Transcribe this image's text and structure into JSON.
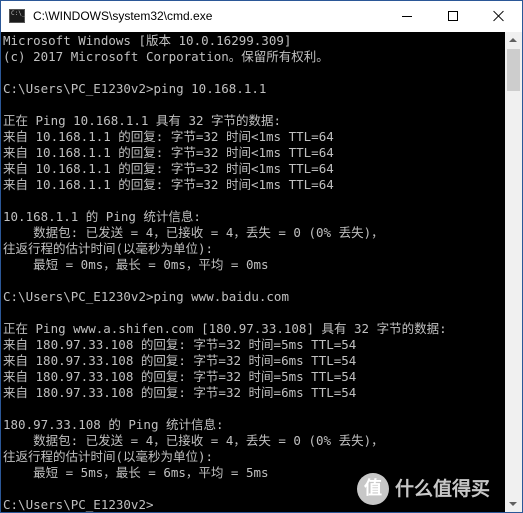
{
  "window": {
    "icon_text": "C:\\_",
    "title": "C:\\WINDOWS\\system32\\cmd.exe"
  },
  "console": {
    "lines": [
      "Microsoft Windows [版本 10.0.16299.309]",
      "(c) 2017 Microsoft Corporation。保留所有权利。",
      "",
      "C:\\Users\\PC_E1230v2>ping 10.168.1.1",
      "",
      "正在 Ping 10.168.1.1 具有 32 字节的数据:",
      "来自 10.168.1.1 的回复: 字节=32 时间<1ms TTL=64",
      "来自 10.168.1.1 的回复: 字节=32 时间<1ms TTL=64",
      "来自 10.168.1.1 的回复: 字节=32 时间<1ms TTL=64",
      "来自 10.168.1.1 的回复: 字节=32 时间<1ms TTL=64",
      "",
      "10.168.1.1 的 Ping 统计信息:",
      "    数据包: 已发送 = 4，已接收 = 4，丢失 = 0 (0% 丢失)，",
      "往返行程的估计时间(以毫秒为单位):",
      "    最短 = 0ms，最长 = 0ms，平均 = 0ms",
      "",
      "C:\\Users\\PC_E1230v2>ping www.baidu.com",
      "",
      "正在 Ping www.a.shifen.com [180.97.33.108] 具有 32 字节的数据:",
      "来自 180.97.33.108 的回复: 字节=32 时间=5ms TTL=54",
      "来自 180.97.33.108 的回复: 字节=32 时间=6ms TTL=54",
      "来自 180.97.33.108 的回复: 字节=32 时间=5ms TTL=54",
      "来自 180.97.33.108 的回复: 字节=32 时间=6ms TTL=54",
      "",
      "180.97.33.108 的 Ping 统计信息:",
      "    数据包: 已发送 = 4，已接收 = 4，丢失 = 0 (0% 丢失)，",
      "往返行程的估计时间(以毫秒为单位):",
      "    最短 = 5ms，最长 = 6ms，平均 = 5ms",
      "",
      "C:\\Users\\PC_E1230v2>"
    ]
  },
  "watermark": {
    "badge": "值",
    "text": "什么值得买"
  },
  "colors": {
    "console_background": "#000000",
    "console_text": "#c0c0c0",
    "titlebar_background": "#ffffff",
    "window_border": "#2b5797",
    "scrollbar_track": "#f0f0f0",
    "scrollbar_thumb": "#cdcdcd"
  },
  "icons": {
    "app": "cmd-icon",
    "minimize": "minimize-icon",
    "maximize": "maximize-icon",
    "close": "close-icon",
    "scroll_up": "arrow-up-icon",
    "scroll_down": "arrow-down-icon",
    "watermark": "smzdm-logo-icon"
  }
}
